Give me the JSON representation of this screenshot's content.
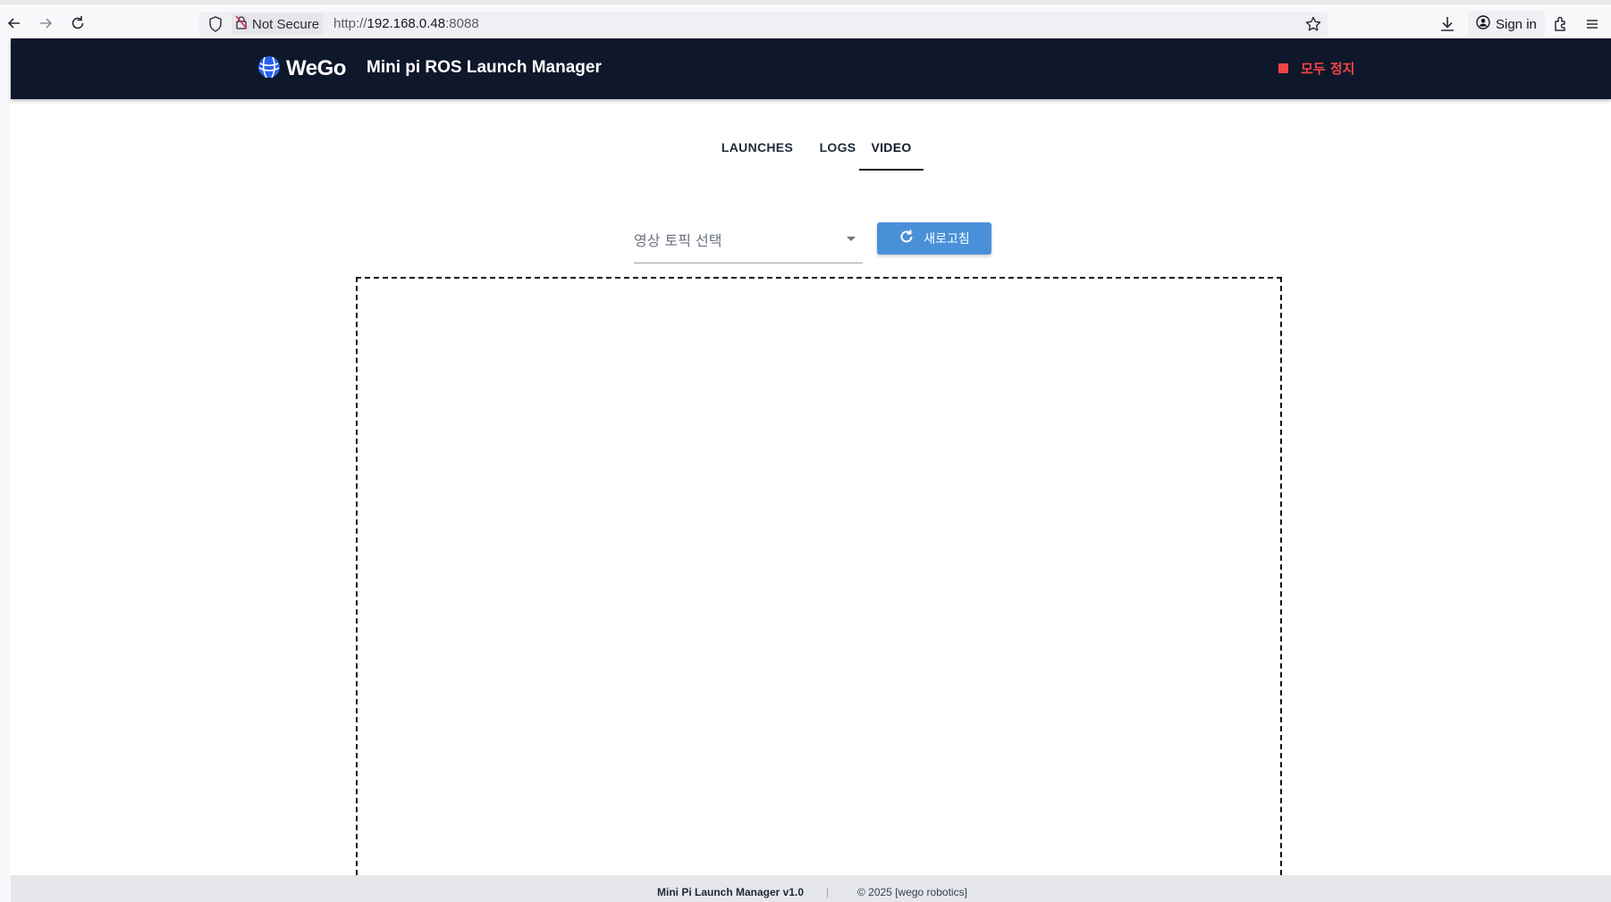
{
  "browser": {
    "not_secure_label": "Not Secure",
    "url_scheme": "http://",
    "url_host": "192.168.0.48",
    "url_port": ":8088",
    "signin_label": "Sign in"
  },
  "header": {
    "logo_text": "WeGo",
    "title": "Mini pi ROS Launch Manager",
    "stop_all_label": "모두 정지"
  },
  "tabs": [
    {
      "label": "LAUNCHES",
      "active": false
    },
    {
      "label": "LOGS",
      "active": false
    },
    {
      "label": "VIDEO",
      "active": true
    }
  ],
  "video": {
    "topic_placeholder": "영상 토픽 선택",
    "refresh_label": "새로고침"
  },
  "footer": {
    "app_name": "Mini Pi Launch Manager v1.0",
    "separator": "|",
    "copyright": "© 2025 [wego robotics]"
  },
  "colors": {
    "header_bg": "#0f172a",
    "stop_red": "#ef4444",
    "refresh_blue": "#4a90d9"
  }
}
